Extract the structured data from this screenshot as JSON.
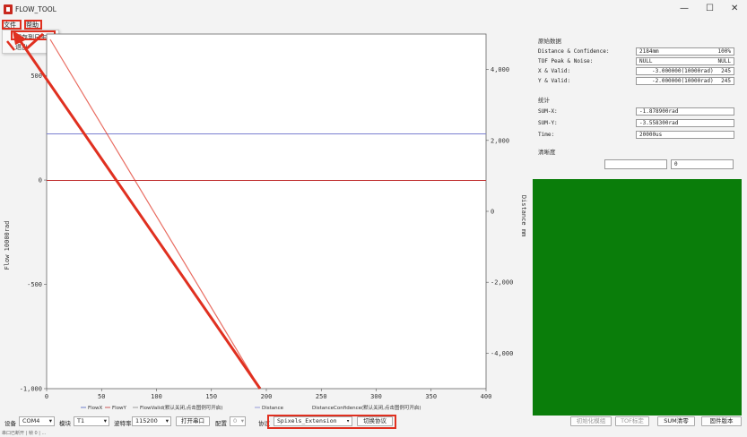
{
  "window": {
    "title": "FLOW_TOOL",
    "minimize": "—",
    "maximize": "☐",
    "close": "✕"
  },
  "menu": {
    "file": "文件",
    "help": "帮助",
    "dropdown": [
      "保存到日志",
      "退出"
    ]
  },
  "plot": {
    "left_ticks": [
      "500",
      "0",
      "-500",
      "-1,000"
    ],
    "left_ylabel": "Flow 10000rad",
    "right_ticks": [
      "4,000",
      "2,000",
      "0",
      "-2,000",
      "-4,000"
    ],
    "right_ylabel": "Distance mm",
    "x_ticks": [
      "0",
      "50",
      "100",
      "150",
      "200",
      "250",
      "300",
      "350",
      "400"
    ],
    "legend": [
      "FlowX",
      "FlowY",
      "FlowValid(默认关闭,点击图例可开启)",
      "Distance",
      "DistanceConfidence(默认关闭,点击图例可开启)"
    ],
    "colors": {
      "flowx": "#4a5fc1",
      "flowy": "#c03030",
      "distance": "#7a80d0"
    }
  },
  "chart_data": {
    "type": "line",
    "x_range": [
      0,
      400
    ],
    "y_left_range": [
      -1000,
      700
    ],
    "y_right_range": [
      -5000,
      5000
    ],
    "xlabel": "",
    "ylabel": "Flow 10000rad",
    "ylabel_right": "Distance mm",
    "series": [
      {
        "name": "FlowX",
        "axis": "left",
        "x": [
          0,
          400
        ],
        "y": [
          -2,
          -2
        ]
      },
      {
        "name": "FlowY",
        "axis": "left",
        "x": [
          0,
          400
        ],
        "y": [
          -2,
          -2
        ]
      },
      {
        "name": "Distance",
        "axis": "right",
        "x": [
          0,
          400
        ],
        "y": [
          2184,
          2184
        ]
      }
    ]
  },
  "panel": {
    "raw_title": "原始数据",
    "raw_rows": [
      {
        "label": "Distance & Confidence:",
        "v1": "2184mm",
        "v2": "100%"
      },
      {
        "label": "TOF Peak & Noise:",
        "v1": "NULL",
        "v2": "NULL"
      },
      {
        "label": "X & Valid:",
        "v1": "-3.000000(10000rad)",
        "v2": "245"
      },
      {
        "label": "Y & Valid:",
        "v1": "-2.000000(10000rad)",
        "v2": "245"
      }
    ],
    "stats_title": "统计",
    "stats_rows": [
      {
        "label": "SUM-X:",
        "value": "-1.878900rad"
      },
      {
        "label": "SUM-Y:",
        "value": "-3.558300rad"
      },
      {
        "label": "Time:",
        "value": "20000us"
      }
    ],
    "clarity_title": "清晰度",
    "clarity_value": "0"
  },
  "bottom": {
    "device_label": "设备",
    "device": "COM4",
    "module_label": "模块",
    "module": "T1",
    "baud_label": "波特率",
    "baud": "115200",
    "open_port": "打开串口",
    "config_label": "配置",
    "config": "0",
    "protocol_label": "协议",
    "protocol": "Spixels_Extension",
    "switch_protocol": "切换协议",
    "init_sensor": "初始化模组",
    "tof_calib": "TOF标定",
    "sum_clear": "SUM清零",
    "firmware": "固件版本"
  },
  "status": "串口已断开 | 帧 0 | ..."
}
